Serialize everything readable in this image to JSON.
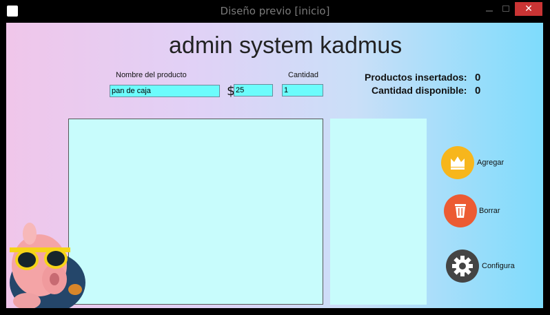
{
  "window": {
    "title": "Diseño previo [inicio]",
    "close_glyph": "✕"
  },
  "header": {
    "title": "admin system kadmus"
  },
  "form": {
    "product_label": "Nombre del producto",
    "product_value": "pan de caja",
    "currency_symbol": "$",
    "price_value": "25",
    "quantity_label": "Cantidad",
    "quantity_value": "1"
  },
  "stats": {
    "inserted_label": "Productos insertados:",
    "inserted_value": "0",
    "available_label": "Cantidad disponible:",
    "available_value": "0"
  },
  "actions": [
    {
      "label": "Agregar",
      "icon": "crown-icon",
      "color": "#f7b61c"
    },
    {
      "label": "Borrar",
      "icon": "trash-icon",
      "color": "#ec5b33"
    },
    {
      "label": "Configura",
      "icon": "gear-icon",
      "color": "#444444"
    }
  ]
}
